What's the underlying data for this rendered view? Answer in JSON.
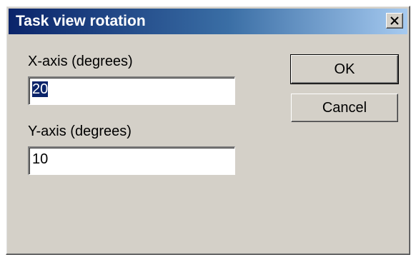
{
  "window": {
    "title": "Task view rotation",
    "close_label": "×"
  },
  "x_axis": {
    "label": "X-axis (degrees)",
    "value": "20"
  },
  "y_axis": {
    "label": "Y-axis (degrees)",
    "value": "10"
  },
  "buttons": {
    "ok": "OK",
    "cancel": "Cancel"
  },
  "icons": {
    "close": "close-icon"
  },
  "colors": {
    "title_start": "#0a246a",
    "title_end": "#a6caf0",
    "dialog_bg": "#d4d0c8",
    "selection": "#0a246a"
  }
}
